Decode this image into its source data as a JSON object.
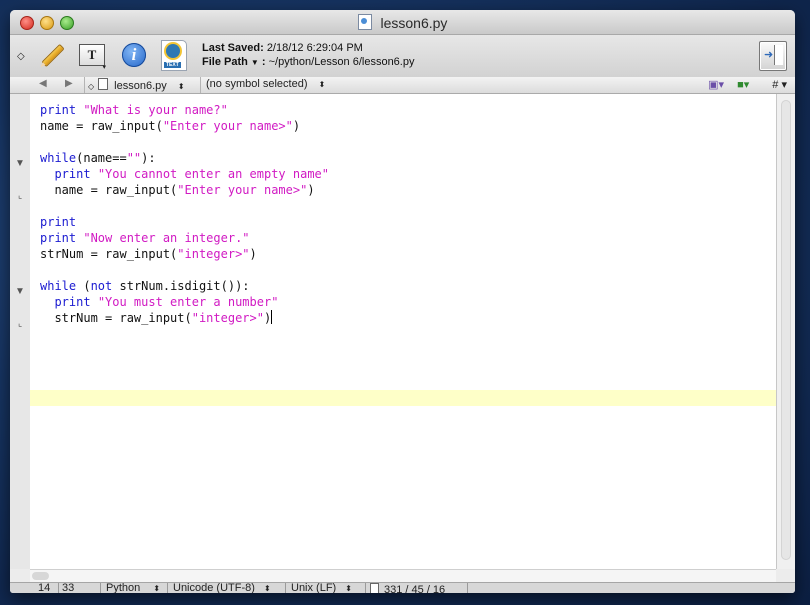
{
  "window": {
    "title": "lesson6.py"
  },
  "toolbar": {
    "last_saved_label": "Last Saved:",
    "last_saved_value": "2/18/12 6:29:04 PM",
    "file_path_label": "File Path",
    "file_path_separator": ":",
    "file_path_value": "~/python/Lesson 6/lesson6.py"
  },
  "navbar": {
    "file_name": "lesson6.py",
    "symbol": "(no symbol selected)",
    "hash": "#"
  },
  "editor": {
    "lines": [
      [
        {
          "t": "print",
          "c": "kw"
        },
        {
          "t": " ",
          "c": "plain"
        },
        {
          "t": "\"What is your name?\"",
          "c": "str"
        }
      ],
      [
        {
          "t": "name = raw_input(",
          "c": "plain"
        },
        {
          "t": "\"Enter your name>\"",
          "c": "str"
        },
        {
          "t": ")",
          "c": "plain"
        }
      ],
      [],
      [
        {
          "t": "while",
          "c": "kw"
        },
        {
          "t": "(name==",
          "c": "plain"
        },
        {
          "t": "\"\"",
          "c": "str"
        },
        {
          "t": "):",
          "c": "plain"
        }
      ],
      [
        {
          "t": "  print",
          "c": "kw"
        },
        {
          "t": " ",
          "c": "plain"
        },
        {
          "t": "\"You cannot enter an empty name\"",
          "c": "str"
        }
      ],
      [
        {
          "t": "  name = raw_input(",
          "c": "plain"
        },
        {
          "t": "\"Enter your name>\"",
          "c": "str"
        },
        {
          "t": ")",
          "c": "plain"
        }
      ],
      [],
      [
        {
          "t": "print",
          "c": "kw"
        }
      ],
      [
        {
          "t": "print",
          "c": "kw"
        },
        {
          "t": " ",
          "c": "plain"
        },
        {
          "t": "\"Now enter an integer.\"",
          "c": "str"
        }
      ],
      [
        {
          "t": "strNum = raw_input(",
          "c": "plain"
        },
        {
          "t": "\"integer>\"",
          "c": "str"
        },
        {
          "t": ")",
          "c": "plain"
        }
      ],
      [],
      [
        {
          "t": "while",
          "c": "kw"
        },
        {
          "t": " (",
          "c": "plain"
        },
        {
          "t": "not",
          "c": "kw"
        },
        {
          "t": " strNum.isdigit()):",
          "c": "plain"
        }
      ],
      [
        {
          "t": "  print",
          "c": "kw"
        },
        {
          "t": " ",
          "c": "plain"
        },
        {
          "t": "\"You must enter a number\"",
          "c": "str"
        }
      ],
      [
        {
          "t": "  strNum = raw_input(",
          "c": "plain"
        },
        {
          "t": "\"integer>\"",
          "c": "str"
        },
        {
          "t": ")",
          "c": "plain"
        }
      ]
    ]
  },
  "status": {
    "line": "14",
    "column": "33",
    "language": "Python",
    "encoding": "Unicode (UTF-8)",
    "line_endings": "Unix (LF)",
    "stats": "331 / 45 / 16"
  }
}
